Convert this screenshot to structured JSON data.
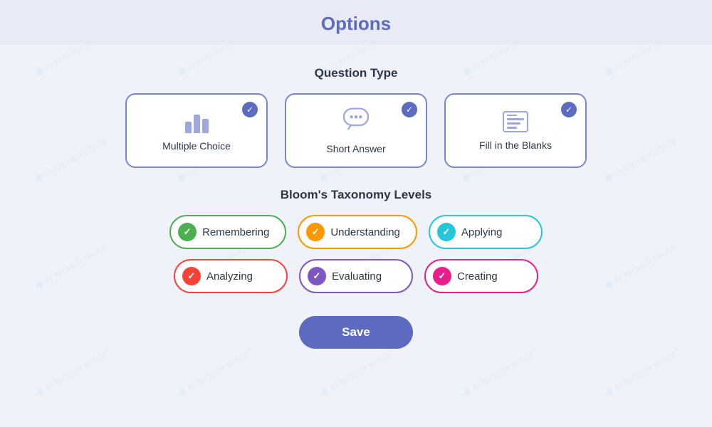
{
  "header": {
    "title": "Options"
  },
  "question_type_section": {
    "label": "Question Type",
    "cards": [
      {
        "id": "multiple-choice",
        "label": "Multiple Choice",
        "icon": "bar-chart",
        "checked": true
      },
      {
        "id": "short-answer",
        "label": "Short Answer",
        "icon": "chat",
        "checked": true
      },
      {
        "id": "fill-in-blanks",
        "label": "Fill in the Blanks",
        "icon": "fill",
        "checked": true
      }
    ]
  },
  "taxonomy_section": {
    "label": "Bloom's Taxonomy Levels",
    "pills": [
      {
        "id": "remembering",
        "label": "Remembering",
        "color": "green",
        "checked": true
      },
      {
        "id": "understanding",
        "label": "Understanding",
        "color": "orange",
        "checked": true
      },
      {
        "id": "applying",
        "label": "Applying",
        "color": "cyan",
        "checked": true
      },
      {
        "id": "analyzing",
        "label": "Analyzing",
        "color": "red",
        "checked": true
      },
      {
        "id": "evaluating",
        "label": "Evaluating",
        "color": "purple",
        "checked": true
      },
      {
        "id": "creating",
        "label": "Creating",
        "color": "pink",
        "checked": true
      }
    ]
  },
  "save_button": {
    "label": "Save"
  },
  "watermark": {
    "text": "AI TACHER SPACE"
  }
}
